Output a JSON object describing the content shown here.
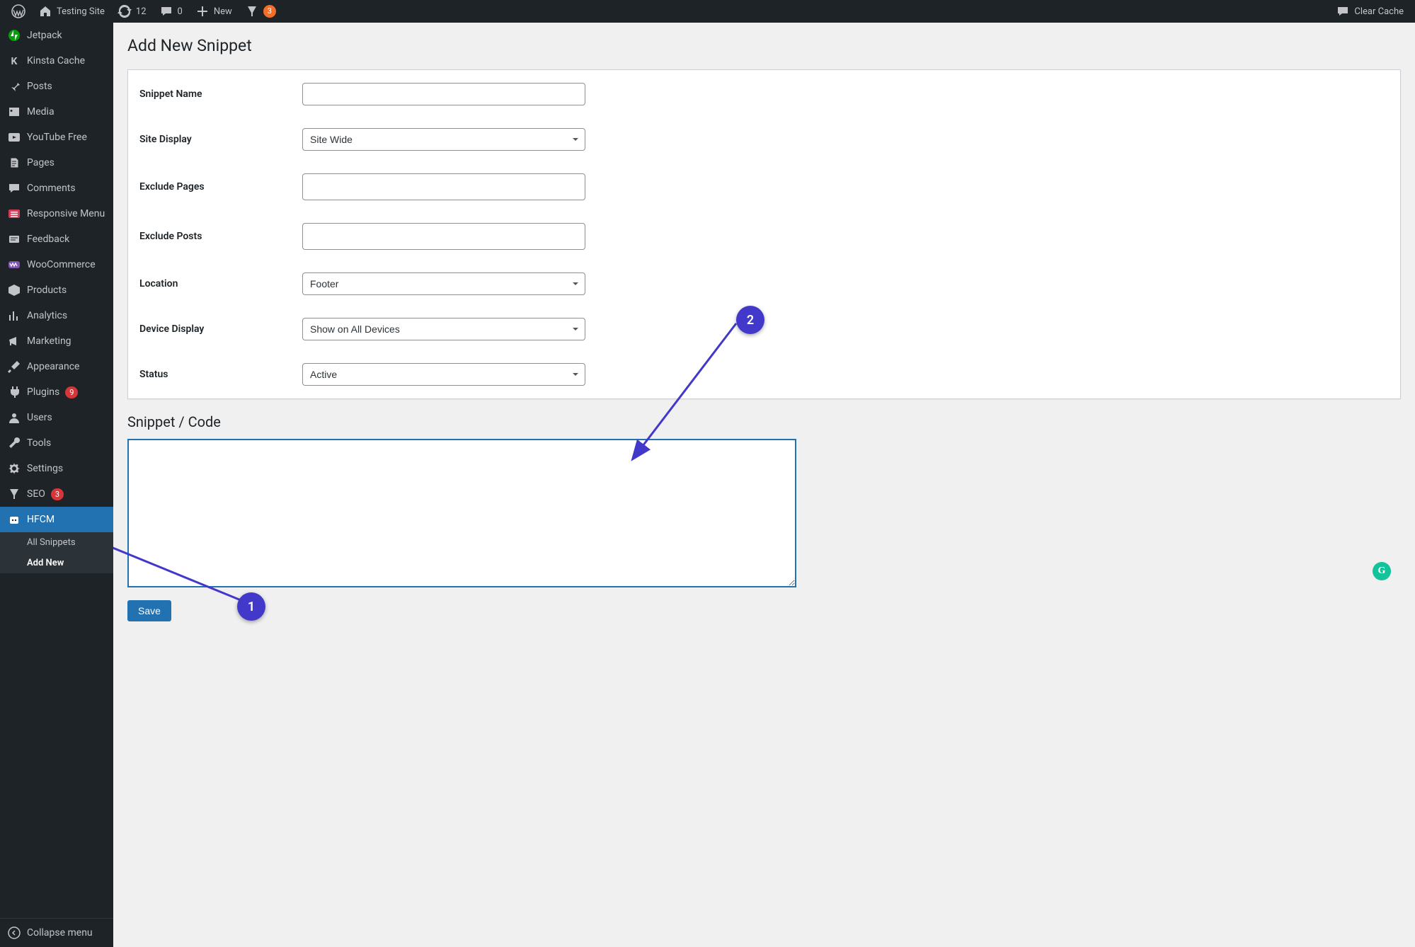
{
  "adminbar": {
    "site_name": "Testing Site",
    "updates_count": "12",
    "comments_count": "0",
    "new_label": "New",
    "yoast_count": "3",
    "clear_cache": "Clear Cache"
  },
  "sidebar": {
    "items": [
      {
        "icon": "jetpack",
        "label": "Jetpack"
      },
      {
        "icon": "kinsta",
        "label": "Kinsta Cache"
      },
      {
        "icon": "pin",
        "label": "Posts"
      },
      {
        "icon": "media",
        "label": "Media"
      },
      {
        "icon": "youtube",
        "label": "YouTube Free"
      },
      {
        "icon": "pages",
        "label": "Pages"
      },
      {
        "icon": "comments",
        "label": "Comments"
      },
      {
        "icon": "responsive",
        "label": "Responsive Menu"
      },
      {
        "icon": "feedback",
        "label": "Feedback"
      },
      {
        "icon": "woo",
        "label": "WooCommerce"
      },
      {
        "icon": "products",
        "label": "Products"
      },
      {
        "icon": "analytics",
        "label": "Analytics"
      },
      {
        "icon": "marketing",
        "label": "Marketing"
      },
      {
        "icon": "appearance",
        "label": "Appearance"
      },
      {
        "icon": "plugins",
        "label": "Plugins",
        "badge": "9"
      },
      {
        "icon": "users",
        "label": "Users"
      },
      {
        "icon": "tools",
        "label": "Tools"
      },
      {
        "icon": "settings",
        "label": "Settings"
      },
      {
        "icon": "seo",
        "label": "SEO",
        "badge": "3"
      },
      {
        "icon": "hfcm",
        "label": "HFCM",
        "current": true
      }
    ],
    "submenu": [
      {
        "label": "All Snippets"
      },
      {
        "label": "Add New",
        "current": true
      }
    ],
    "collapse_label": "Collapse menu"
  },
  "page": {
    "title": "Add New Snippet",
    "section_code": "Snippet / Code",
    "save_label": "Save"
  },
  "form": {
    "snippet_name": {
      "label": "Snippet Name",
      "value": ""
    },
    "site_display": {
      "label": "Site Display",
      "value": "Site Wide"
    },
    "exclude_pages": {
      "label": "Exclude Pages",
      "value": ""
    },
    "exclude_posts": {
      "label": "Exclude Posts",
      "value": ""
    },
    "location": {
      "label": "Location",
      "value": "Footer"
    },
    "device_display": {
      "label": "Device Display",
      "value": "Show on All Devices"
    },
    "status": {
      "label": "Status",
      "value": "Active"
    },
    "code": ""
  },
  "annotations": {
    "1": "1",
    "2": "2"
  }
}
